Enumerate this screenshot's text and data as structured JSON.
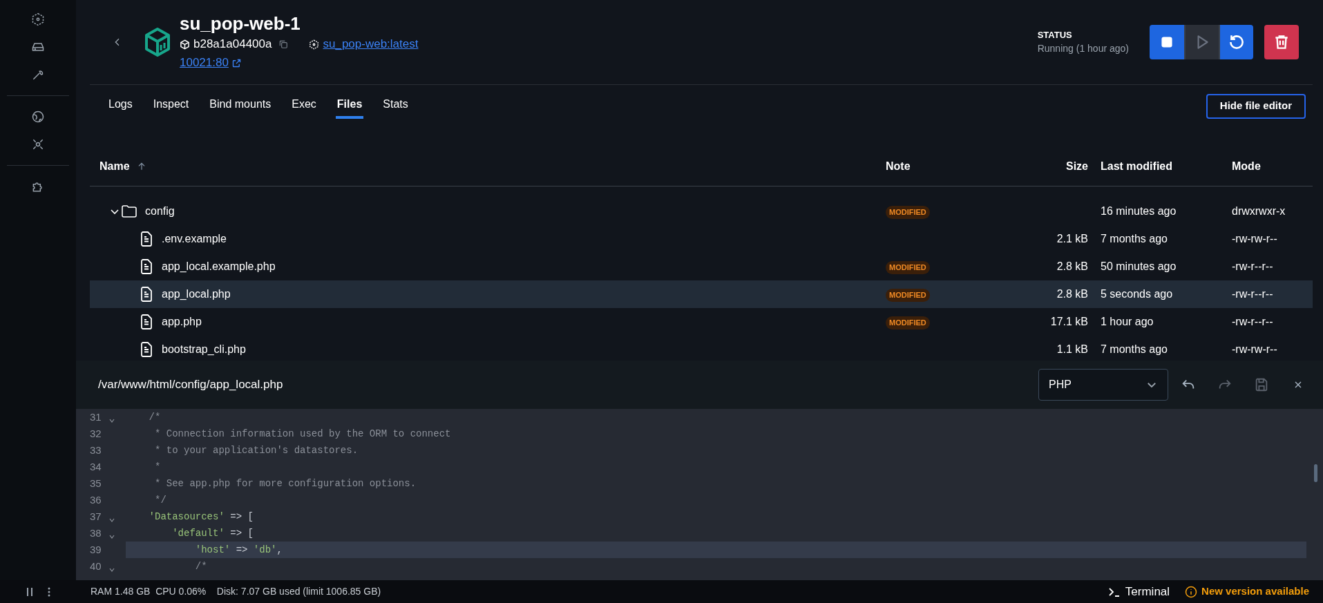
{
  "container": {
    "name": "su_pop-web-1",
    "id": "b28a1a04400a",
    "image": "su_pop-web:latest",
    "port": "10021:80",
    "status_label": "STATUS",
    "status": "Running (1 hour ago)"
  },
  "actions": [
    {
      "kind": "stop",
      "disabled": false
    },
    {
      "kind": "start",
      "disabled": true
    },
    {
      "kind": "restart",
      "disabled": false
    },
    {
      "kind": "delete",
      "disabled": false
    }
  ],
  "tabs": [
    {
      "label": "Logs",
      "selected": false
    },
    {
      "label": "Inspect",
      "selected": false
    },
    {
      "label": "Bind mounts",
      "selected": false
    },
    {
      "label": "Exec",
      "selected": false
    },
    {
      "label": "Files",
      "selected": true
    },
    {
      "label": "Stats",
      "selected": false
    }
  ],
  "hide_editor_button": "Hide file editor",
  "table": {
    "columns": [
      "Name",
      "Note",
      "Size",
      "Last modified",
      "Mode"
    ],
    "rows": [
      {
        "kind": "folder",
        "name": "config",
        "expanded": true,
        "note": "MODIFIED",
        "modified": "16 minutes ago",
        "mode": "drwxrwxr-x",
        "selected": false,
        "children": [
          {
            "kind": "file",
            "name": ".env.example",
            "size": "2.1 kB",
            "modified": "7 months ago",
            "mode": "-rw-rw-r--",
            "selected": false
          },
          {
            "kind": "file",
            "name": "app_local.example.php",
            "note": "MODIFIED",
            "size": "2.8 kB",
            "modified": "50 minutes ago",
            "mode": "-rw-r--r--",
            "selected": false
          },
          {
            "kind": "file",
            "name": "app_local.php",
            "note": "MODIFIED",
            "size": "2.8 kB",
            "modified": "5 seconds ago",
            "mode": "-rw-r--r--",
            "selected": true
          },
          {
            "kind": "file",
            "name": "app.php",
            "note": "MODIFIED",
            "size": "17.1 kB",
            "modified": "1 hour ago",
            "mode": "-rw-r--r--",
            "selected": false
          },
          {
            "kind": "file",
            "name": "bootstrap_cli.php",
            "size": "1.1 kB",
            "modified": "7 months ago",
            "mode": "-rw-rw-r--",
            "selected": false
          }
        ]
      }
    ]
  },
  "editor": {
    "path": "/var/www/html/config/app_local.php",
    "language": "PHP",
    "tools": [
      {
        "kind": "undo",
        "disabled": false
      },
      {
        "kind": "redo",
        "disabled": true
      },
      {
        "kind": "save",
        "disabled": true
      },
      {
        "kind": "close",
        "disabled": false
      }
    ],
    "lines": [
      {
        "number": "31",
        "fold": true,
        "active": false,
        "tokens": [
          {
            "kind": "comment",
            "text": "    /*"
          }
        ]
      },
      {
        "number": "32",
        "fold": false,
        "active": false,
        "tokens": [
          {
            "kind": "comment",
            "text": "     * Connection information used by the ORM to connect"
          }
        ]
      },
      {
        "number": "33",
        "fold": false,
        "active": false,
        "tokens": [
          {
            "kind": "comment",
            "text": "     * to your application's datastores."
          }
        ]
      },
      {
        "number": "34",
        "fold": false,
        "active": false,
        "tokens": [
          {
            "kind": "comment",
            "text": "     *"
          }
        ]
      },
      {
        "number": "35",
        "fold": false,
        "active": false,
        "tokens": [
          {
            "kind": "comment",
            "text": "     * See app.php for more configuration options."
          }
        ]
      },
      {
        "number": "36",
        "fold": false,
        "active": false,
        "tokens": [
          {
            "kind": "comment",
            "text": "     */"
          }
        ]
      },
      {
        "number": "37",
        "fold": true,
        "active": false,
        "tokens": [
          {
            "kind": "string",
            "text": "    'Datasources'"
          },
          {
            "kind": "plain",
            "text": " => ["
          }
        ]
      },
      {
        "number": "38",
        "fold": true,
        "active": false,
        "tokens": [
          {
            "kind": "string",
            "text": "        'default'"
          },
          {
            "kind": "plain",
            "text": " => ["
          }
        ]
      },
      {
        "number": "39",
        "fold": false,
        "active": true,
        "tokens": [
          {
            "kind": "string",
            "text": "            'host'"
          },
          {
            "kind": "plain",
            "text": " => "
          },
          {
            "kind": "string",
            "text": "'db'"
          },
          {
            "kind": "plain",
            "text": ","
          }
        ]
      },
      {
        "number": "40",
        "fold": true,
        "active": false,
        "tokens": [
          {
            "kind": "comment",
            "text": "            /*"
          }
        ]
      }
    ]
  },
  "status_bar": {
    "stats": "RAM 1.48 GB  CPU 0.06%    Disk: 7.07 GB used (limit 1006.85 GB)",
    "terminal": "Terminal",
    "update": "New version available"
  }
}
